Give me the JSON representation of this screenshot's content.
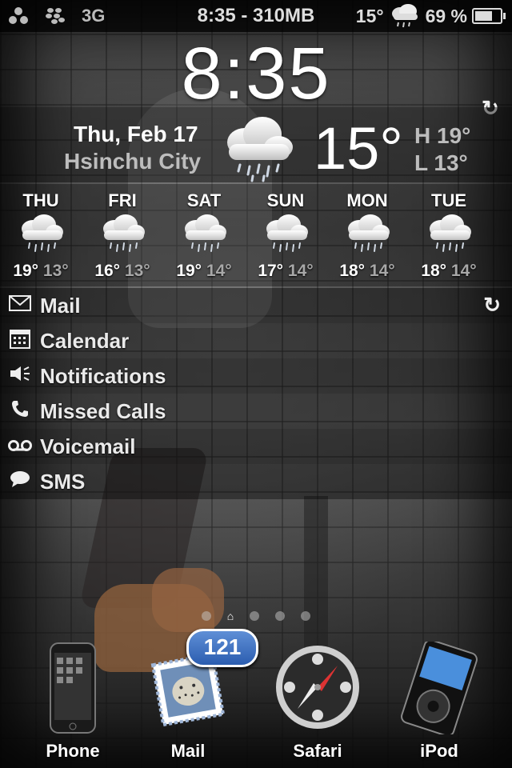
{
  "status_bar": {
    "carrier": "3G",
    "center_text": "8:35 - 310MB",
    "weather_temp": "15°",
    "battery_percent": "69 %",
    "battery_level": 0.69
  },
  "clock": {
    "time": "8:35"
  },
  "weather": {
    "date": "Thu, Feb 17",
    "city": "Hsinchu City",
    "current_temp": "15°",
    "high": "H 19°",
    "low": "L 13°",
    "condition_icon": "rain-cloud-icon"
  },
  "forecast": [
    {
      "day": "THU",
      "high": "19°",
      "low": "13°"
    },
    {
      "day": "FRI",
      "high": "16°",
      "low": "13°"
    },
    {
      "day": "SAT",
      "high": "19°",
      "low": "14°"
    },
    {
      "day": "SUN",
      "high": "17°",
      "low": "14°"
    },
    {
      "day": "MON",
      "high": "18°",
      "low": "14°"
    },
    {
      "day": "TUE",
      "high": "18°",
      "low": "14°"
    }
  ],
  "notifications": {
    "items": [
      {
        "label": "Mail",
        "icon": "envelope-icon"
      },
      {
        "label": "Calendar",
        "icon": "calendar-icon"
      },
      {
        "label": "Notifications",
        "icon": "speaker-icon"
      },
      {
        "label": "Missed Calls",
        "icon": "phone-icon"
      },
      {
        "label": "Voicemail",
        "icon": "voicemail-icon"
      },
      {
        "label": "SMS",
        "icon": "chat-bubble-icon"
      }
    ]
  },
  "dock": {
    "apps": [
      {
        "label": "Phone"
      },
      {
        "label": "Mail",
        "badge": "121"
      },
      {
        "label": "Safari"
      },
      {
        "label": "iPod"
      }
    ]
  },
  "colors": {
    "badge": "#2b5db0",
    "secondary_text": "#bdbdbd"
  }
}
